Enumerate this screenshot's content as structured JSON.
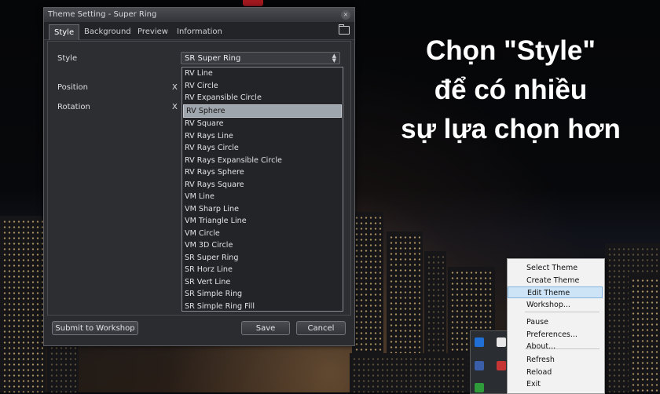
{
  "headline": {
    "line1": "Chọn \"Style\"",
    "line2": "để có nhiều",
    "line3": "sự lựa chọn hơn"
  },
  "window": {
    "title": "Theme Setting - Super Ring",
    "close_glyph": "×",
    "tabs": [
      "Style",
      "Background",
      "Preview",
      "Information"
    ],
    "active_tab": "Style",
    "folder_icon": "folder-icon"
  },
  "form": {
    "style_label": "Style",
    "style_value": "SR Super Ring",
    "position_label": "Position",
    "rotation_label": "Rotation",
    "x_label": "X",
    "spin_up": "▲",
    "spin_down": "▼"
  },
  "dropdown": {
    "selected": "RV Sphere",
    "options": [
      "RV Line",
      "RV Circle",
      "RV Expansible Circle",
      "RV Sphere",
      "RV Square",
      "RV Rays Line",
      "RV Rays Circle",
      "RV Rays Expansible Circle",
      "RV Rays Sphere",
      "RV Rays Square",
      "VM Line",
      "VM Sharp Line",
      "VM Triangle Line",
      "VM Circle",
      "VM 3D Circle",
      "SR Super Ring",
      "SR Horz Line",
      "SR Vert Line",
      "SR Simple Ring",
      "SR Simple Ring Fill"
    ]
  },
  "buttons": {
    "workshop": "Submit to Workshop",
    "save": "Save",
    "cancel": "Cancel"
  },
  "context_menu": {
    "highlighted": "Edit Theme",
    "group1": [
      "Select Theme",
      "Create Theme",
      "Edit Theme",
      "Workshop..."
    ],
    "group2": [
      "Pause",
      "Preferences...",
      "About..."
    ],
    "group3": [
      "Refresh",
      "Reload",
      "Exit"
    ]
  },
  "tray": {
    "icons": [
      "bluetooth-icon",
      "antivirus-icon",
      "app-icon",
      "battery-icon"
    ]
  },
  "colors": {
    "highlight": "#9fa5ad",
    "menu_highlight": "#cde4f7"
  }
}
